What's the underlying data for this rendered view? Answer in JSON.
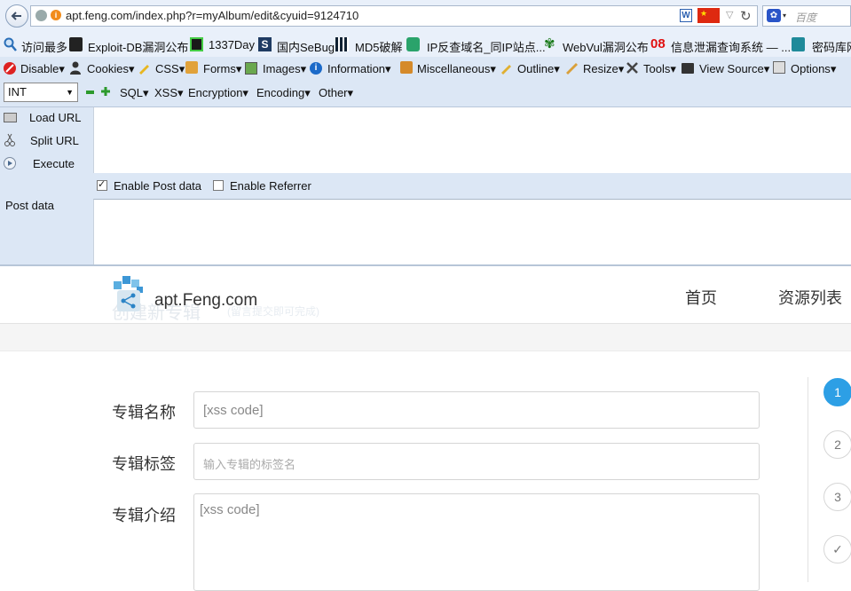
{
  "browser": {
    "url": "apt.feng.com/index.php?r=myAlbum/edit&cyuid=9124710",
    "search_placeholder": "百度",
    "w_badge": "W"
  },
  "bookmarks": [
    {
      "label": "访问最多",
      "icon": "search-gear-icon"
    },
    {
      "label": "Exploit-DB漏洞公布",
      "icon": "exploit-db-icon"
    },
    {
      "label": "1337Day",
      "icon": "1337day-icon"
    },
    {
      "label": "国内SeBug",
      "icon": "sebug-icon"
    },
    {
      "label": "MD5破解",
      "icon": "md5-grid-icon"
    },
    {
      "label": "IP反查域名_同IP站点...",
      "icon": "ip-lookup-icon"
    },
    {
      "label": "WebVul漏洞公布",
      "icon": "webvul-icon"
    },
    {
      "label": "信息泄漏查询系统 — ...",
      "icon": "08-icon",
      "icon_text": "08"
    },
    {
      "label": "密码库网",
      "icon": "key-icon"
    }
  ],
  "hackbar": {
    "menu1": [
      "Disable",
      "Cookies",
      "CSS",
      "Forms",
      "Images",
      "Information",
      "Miscellaneous",
      "Outline",
      "Resize",
      "Tools",
      "View Source",
      "Options"
    ],
    "menu2": [
      "SQL",
      "XSS",
      "Encryption",
      "Encoding",
      "Other"
    ],
    "int_value": "INT",
    "load_url": "Load URL",
    "split_url": "Split URL",
    "execute": "Execute",
    "enable_post": "Enable Post data",
    "enable_referrer": "Enable Referrer",
    "post_data_label": "Post data"
  },
  "site": {
    "logo_text": "apt.Feng.com",
    "ghost_title": "创建新专辑",
    "ghost_sub": "(留言提交即可完成)",
    "nav": [
      "首页",
      "资源列表"
    ]
  },
  "form": {
    "name_label": "专辑名称",
    "name_value": "[xss code]",
    "tags_label": "专辑标签",
    "tags_placeholder": "输入专辑的标签名",
    "intro_label": "专辑介绍",
    "intro_value": "[xss code]"
  },
  "steps": [
    "1",
    "2",
    "3",
    "✓"
  ],
  "colors": {
    "accent": "#2d9fe5",
    "toolbar_bg": "#dce7f5"
  }
}
